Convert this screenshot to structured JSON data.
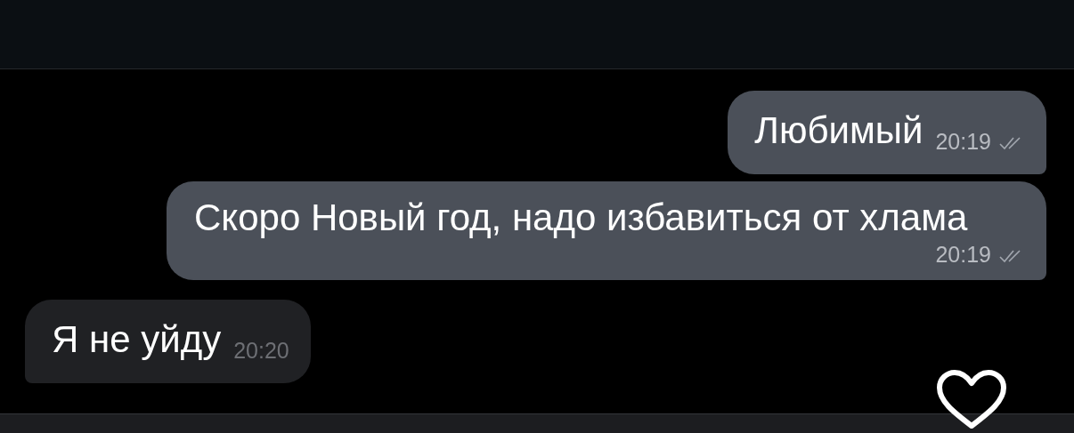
{
  "messages": [
    {
      "kind": "outgoing",
      "time_below": false,
      "text": "Любимый",
      "time": "20:19",
      "read": true
    },
    {
      "kind": "outgoing",
      "time_below": true,
      "text": "Скоро Новый год, надо избавиться от хлама",
      "time": "20:19",
      "read": true
    },
    {
      "kind": "incoming",
      "time_below": false,
      "text": "Я не уйду",
      "time": "20:20",
      "read": false
    }
  ]
}
